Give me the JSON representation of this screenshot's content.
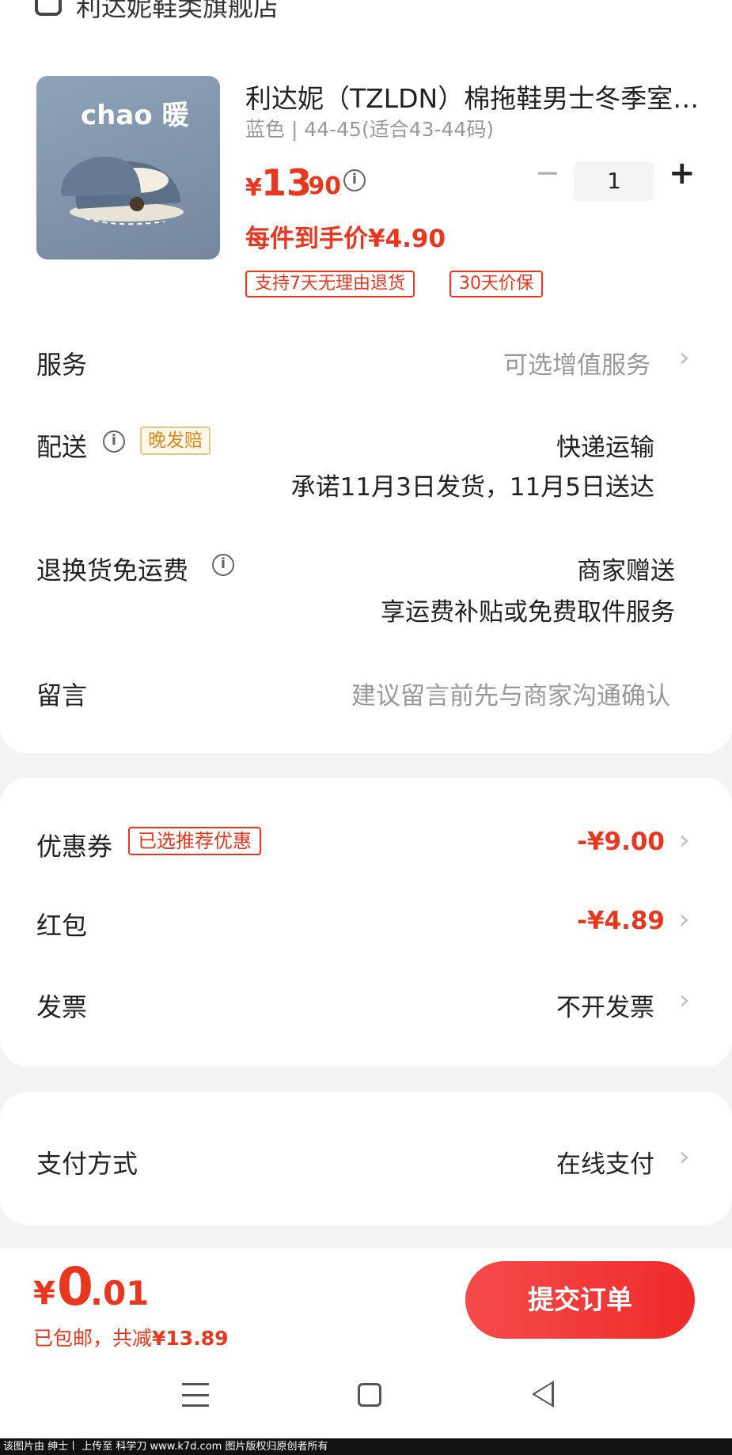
{
  "store": {
    "name": "利达妮鞋类旗舰店",
    "icon": "store-icon"
  },
  "product": {
    "image_caption": "chao 暖",
    "title": "利达妮（TZLDN）棉拖鞋男士冬季室…",
    "spec": "蓝色 | 44-45(适合43-44码)",
    "price_symbol": "¥",
    "price_int": "13",
    "price_dec": ".90",
    "quantity": "1",
    "per_item_price": "每件到手价¥4.90",
    "tags": [
      "支持7天无理由退货",
      "30天价保"
    ]
  },
  "service": {
    "label": "服务",
    "value": "可选增值服务"
  },
  "delivery": {
    "label": "配送",
    "badge": "晚发赔",
    "method": "快递运输",
    "promise": "承诺11月3日发货，11月5日送达"
  },
  "return_shipping": {
    "label": "退换货免运费",
    "value": "商家赠送",
    "detail": "享运费补贴或免费取件服务"
  },
  "message": {
    "label": "留言",
    "placeholder": "建议留言前先与商家沟通确认"
  },
  "coupon": {
    "label": "优惠券",
    "badge": "已选推荐优惠",
    "value": "-¥9.00"
  },
  "red_packet": {
    "label": "红包",
    "value": "-¥4.89"
  },
  "invoice": {
    "label": "发票",
    "value": "不开发票"
  },
  "payment": {
    "label": "支付方式",
    "value": "在线支付"
  },
  "footer": {
    "total_symbol": "¥",
    "total_int": "0",
    "total_dec": ".01",
    "free_shipping": "已包邮，共减",
    "saved": "¥13.89",
    "submit_label": "提交订单"
  },
  "watermark": "该图片由 绅士丨 上传至 科学刀 www.k7d.com 图片版权归原创者所有",
  "colors": {
    "accent": "#e8361f",
    "button": "#ef2a2a",
    "badge_orange": "#d98a1c"
  }
}
